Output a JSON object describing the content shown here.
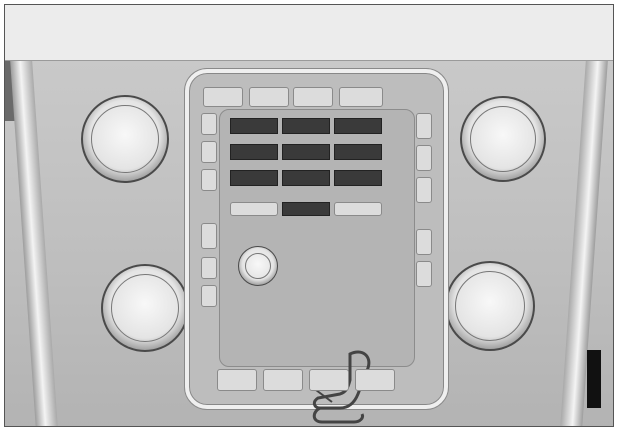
{
  "top_row": [
    "",
    "",
    "",
    ""
  ],
  "left_col": [
    "",
    "",
    "",
    "",
    "",
    ""
  ],
  "right_col": [
    "",
    "",
    "",
    "",
    ""
  ],
  "num_grid": [
    [
      "",
      "",
      ""
    ],
    [
      "",
      "",
      ""
    ],
    [
      "",
      "",
      ""
    ]
  ],
  "bottom_row": [
    "",
    "",
    "",
    ""
  ],
  "side_code": "",
  "knobs": [
    "",
    "",
    "",
    ""
  ]
}
